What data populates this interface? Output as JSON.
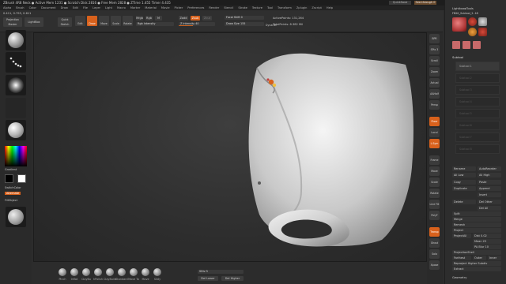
{
  "title_bar": {
    "title": "ZBrush 4R8   Neck   ● Active Mem 1231 ● Scratch Disk 2816 ● Free Mem 2828 ● ZTime 1.455  Timer 4.435",
    "quicksave": "QuickSave",
    "see_through": "See-through 0",
    "menus": "Menus",
    "default_zscript": "DefaultZScript"
  },
  "menubar": [
    "Alpha",
    "Brush",
    "Color",
    "Document",
    "Draw",
    "Edit",
    "File",
    "Layer",
    "Light",
    "Macro",
    "Marker",
    "Material",
    "Movie",
    "Picker",
    "Preferences",
    "Render",
    "Stencil",
    "Stroke",
    "Texture",
    "Tool",
    "Transform",
    "Zplugin",
    "Zscript",
    "Help"
  ],
  "toolbar": {
    "coords": "0.411, 0.795, 0.611",
    "projection_master": "Projection Master",
    "lightbox": "LightBox",
    "quick_sketch": "Quick Sketch",
    "edit": "Edit",
    "draw": "Draw",
    "move": "Move",
    "scale": "Scale",
    "rotate": "Rotate",
    "mrgb": "Mrgb",
    "rgb": "Rgb",
    "m": "M",
    "rgb_intensity": "Rgb Intensity",
    "zadd": "Zadd",
    "zsub": "Zsub",
    "zcut": "Zcut",
    "z_intensity": "Z Intensity 40",
    "focal_shift": "Focal Shift 0",
    "draw_size": "Draw Size 155",
    "dynamic": "Dynamic",
    "active_points": "ActivePoints: 131,264",
    "total_points": "TotalPoints: 8.382 Mil"
  },
  "left_shelf": {
    "gradient": "Gradient",
    "switch_color": "SwitchColor",
    "alternate": "Alternate",
    "fill_object": "FillObject",
    "main_color": "#ffffff",
    "accent": "#d8611c"
  },
  "right_shelf": {
    "buttons": [
      "BPR",
      "SPix 3",
      "Scroll",
      "Zoom",
      "Actual",
      "AAHalf",
      "Persp",
      "Floor",
      "Local",
      "L.Sym",
      "Frame",
      "Move",
      "Scale",
      "Rotate",
      "Line Fill",
      "PolyF",
      "Transp",
      "Ghost",
      "Solo",
      "Xpose"
    ]
  },
  "tray": {
    "lightbox_tools": "Lightbox▸Tools",
    "tool_name": "FBX0_Subtool_2. 48",
    "subtool_header": "Subtool",
    "subtools": [
      "Subtool 1",
      "Subtool 2",
      "Subtool 3",
      "Subtool 4",
      "Subtool 5",
      "Subtool 6",
      "Subtool 7",
      "Subtool 8"
    ],
    "rename": "Rename",
    "autoreorder": "AutoReorder",
    "all_low": "All Low",
    "all_high": "All High",
    "copy": "Copy",
    "paste": "Paste",
    "duplicate": "Duplicate",
    "append": "Append",
    "insert": "Insert",
    "delete": "Delete",
    "del_other": "Del Other",
    "del_all": "Del All",
    "split": "Split",
    "merge": "Merge",
    "remesh": "Remesh",
    "project": "Project",
    "project_all": "ProjectAll",
    "dist": "Dist 0.02",
    "mean": "Mean 25",
    "pa_blur": "PA Blur 10",
    "projection_shell": "ProjectionShell",
    "farthest": "Farthest",
    "outer": "Outer",
    "inner": "Inner",
    "reproject_higher_subdiv": "Reproject Higher Subdiv",
    "extract": "Extract",
    "geometry": "Geometry"
  },
  "bottom": {
    "sdiv": "SDiv 5",
    "del_lower": "Del Lower",
    "del_higher": "Del Higher",
    "brushes": [
      "Pinch",
      "Inflat",
      "ClayBu",
      "hPolish",
      "ClayBuild",
      "Standard",
      "Move To",
      "Move",
      "Slidy"
    ]
  }
}
